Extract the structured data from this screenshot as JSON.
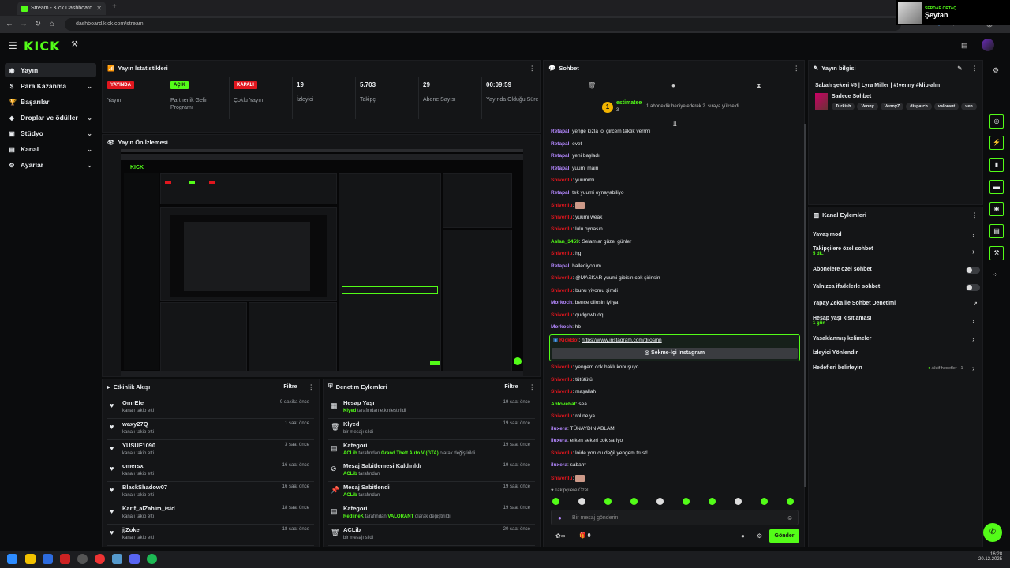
{
  "browser": {
    "tab_title": "Stream - Kick Dashboard",
    "url": "dashboard.kick.com/stream",
    "new_tab": "+"
  },
  "overlay": {
    "name_small": "SERDAR ORTAÇ",
    "name_large": "Şeytan"
  },
  "header": {
    "logo": "KICK"
  },
  "sidebar": {
    "items": [
      {
        "label": "Yayın",
        "icon": "broadcast-icon",
        "chev": ""
      },
      {
        "label": "Para Kazanma",
        "icon": "money-icon",
        "chev": "⌄"
      },
      {
        "label": "Başarılar",
        "icon": "trophy-icon",
        "chev": ""
      },
      {
        "label": "Droplar ve ödüller",
        "icon": "gift-icon",
        "chev": "⌄"
      },
      {
        "label": "Stüdyo",
        "icon": "studio-icon",
        "chev": "⌄"
      },
      {
        "label": "Kanal",
        "icon": "channel-icon",
        "chev": "⌄"
      },
      {
        "label": "Ayarlar",
        "icon": "gear-icon",
        "chev": "⌄"
      }
    ]
  },
  "stats": {
    "title": "Yayın İstatistikleri",
    "items": [
      {
        "value": "YAYINDA",
        "label": "Yayın",
        "kind": "red"
      },
      {
        "value": "AÇIK",
        "label": "Partnerlik Gelir Programı",
        "kind": "green"
      },
      {
        "value": "KAPALI",
        "label": "Çoklu Yayın",
        "kind": "red"
      },
      {
        "value": "19",
        "label": "İzleyici",
        "kind": "num"
      },
      {
        "value": "5.703",
        "label": "Takipçi",
        "kind": "num"
      },
      {
        "value": "29",
        "label": "Abone Sayısı",
        "kind": "num"
      },
      {
        "value": "00:09:59",
        "label": "Yayında Olduğu Süre",
        "kind": "num"
      }
    ]
  },
  "preview": {
    "title": "Yayın Ön İzlemesi"
  },
  "activity": {
    "title": "Etkinlik Akışı",
    "filter": "Filtre",
    "rows": [
      {
        "name": "OmrEfe",
        "sub": "kanalı takip etti",
        "time": "9 dakika önce"
      },
      {
        "name": "waxy27Q",
        "sub": "kanalı takip etti",
        "time": "1 saat önce"
      },
      {
        "name": "YUSUF1090",
        "sub": "kanalı takip etti",
        "time": "3 saat önce"
      },
      {
        "name": "omersx",
        "sub": "kanalı takip etti",
        "time": "16 saat önce"
      },
      {
        "name": "BlackShadow07",
        "sub": "kanalı takip etti",
        "time": "16 saat önce"
      },
      {
        "name": "Karif_alZahim_isid",
        "sub": "kanalı takip etti",
        "time": "18 saat önce"
      },
      {
        "name": "jjZoke",
        "sub": "kanalı takip etti",
        "time": "18 saat önce"
      }
    ]
  },
  "moderation": {
    "title": "Denetim Eylemleri",
    "filter": "Filtre",
    "rows": [
      {
        "name": "Hesap Yaşı",
        "actor": "Klyed",
        "sub": " tarafından etkinleştirildi",
        "extra": "",
        "tail": "",
        "time": "19 saat önce",
        "icon": "calendar-icon"
      },
      {
        "name": "Klyed",
        "actor": "",
        "sub": "bir mesajı sildi",
        "extra": "",
        "tail": "",
        "time": "19 saat önce",
        "icon": "trash-icon"
      },
      {
        "name": "Kategori",
        "actor": "ACLib",
        "sub": " tarafından ",
        "extra": "Grand Theft Auto V (GTA)",
        "tail": " olarak değiştirildi",
        "time": "19 saat önce",
        "icon": "category-icon"
      },
      {
        "name": "Mesaj Sabitlemesi Kaldırıldı",
        "actor": "ACLib",
        "sub": " tarafından",
        "extra": "",
        "tail": "",
        "time": "19 saat önce",
        "icon": "unpin-icon"
      },
      {
        "name": "Mesaj Sabitlendi",
        "actor": "ACLib",
        "sub": " tarafından",
        "extra": "",
        "tail": "",
        "time": "19 saat önce",
        "icon": "pin-icon"
      },
      {
        "name": "Kategori",
        "actor": "RedlineK",
        "sub": " tarafından ",
        "extra": "VALORANT",
        "tail": " olarak değiştirildi",
        "time": "19 saat önce",
        "icon": "category-icon"
      },
      {
        "name": "ACLib",
        "actor": "",
        "sub": "bir mesajı sildi",
        "extra": "",
        "tail": "",
        "time": "20 saat önce",
        "icon": "trash-icon"
      }
    ]
  },
  "chat": {
    "title": "Sohbet",
    "gift_user": "estimatee",
    "gift_count": "3",
    "gift_text": "1 aboneklik hediye ederek 2. sıraya yükseldi",
    "messages": [
      {
        "user": "Retapal",
        "text": "yenge kızla lol gircem taktik verrmi",
        "color": "#b488ff"
      },
      {
        "user": "Retapal",
        "text": "evet",
        "color": "#b488ff"
      },
      {
        "user": "Retapal",
        "text": "yeni başladı",
        "color": "#b488ff"
      },
      {
        "user": "Retapal",
        "text": "yuumi main",
        "color": "#b488ff"
      },
      {
        "user": "Shiverllu",
        "text": "yuumimi",
        "color": "#e0161e"
      },
      {
        "user": "Retapal",
        "text": "tek yuumi oynayabiliyo",
        "color": "#b488ff"
      },
      {
        "user": "Shiverllu",
        "text": "",
        "color": "#e0161e"
      },
      {
        "user": "Shiverllu",
        "text": "yuumi weak",
        "color": "#e0161e"
      },
      {
        "user": "Shiverllu",
        "text": "lulu oynasın",
        "color": "#e0161e"
      },
      {
        "user": "Aslan_3459",
        "text": "Selamlar güzel günler",
        "color": "#53fc18"
      },
      {
        "user": "Shiverllu",
        "text": "hg",
        "color": "#e0161e"
      },
      {
        "user": "Retapal",
        "text": "hallediyorum",
        "color": "#b488ff"
      },
      {
        "user": "Shiverllu",
        "text": "@MASKAR yuumi gibisin cok şirinsin",
        "color": "#e0161e"
      },
      {
        "user": "Shiverllu",
        "text": "bunu yiyomu şimdi",
        "color": "#e0161e"
      },
      {
        "user": "Morkoch",
        "text": "bence dilosin iyi ya",
        "color": "#b488ff"
      },
      {
        "user": "Shiverllu",
        "text": "qudgqwtudq",
        "color": "#e0161e"
      },
      {
        "user": "Morkoch",
        "text": "hb",
        "color": "#b488ff"
      }
    ],
    "bot_user": "KickBot",
    "bot_link": "https://www.instagram.com/dilosinn",
    "bot_button": "Sekme-İçi Instagram",
    "messages2": [
      {
        "user": "Shiverllu",
        "text": "yengem cok haklı konuşuyo",
        "color": "#e0161e"
      },
      {
        "user": "Shiverllu",
        "text": "tütütütü",
        "color": "#e0161e"
      },
      {
        "user": "Shiverllu",
        "text": "maşallah",
        "color": "#e0161e"
      },
      {
        "user": "Antovehat",
        "text": "sea",
        "color": "#53fc18"
      },
      {
        "user": "Shiverllu",
        "text": "rol ne ya",
        "color": "#e0161e"
      },
      {
        "user": "iluxera",
        "text": "TÜNAYDIN ABLAM",
        "color": "#b488ff"
      },
      {
        "user": "iluxera",
        "text": "erken sekeri cok sarlyo",
        "color": "#b488ff"
      },
      {
        "user": "Shiverllu",
        "text": "loide yorucu değil yengem trust!",
        "color": "#e0161e"
      },
      {
        "user": "iluxera",
        "text": "sabah*",
        "color": "#b488ff"
      },
      {
        "user": "Shiverllu",
        "text": "",
        "color": "#e0161e"
      }
    ],
    "followers_only": "Takipçilere Özel",
    "input_placeholder": "Bir mesaj gönderin",
    "count": "0",
    "send": "Gönder"
  },
  "stream_info": {
    "title": "Yayın bilgisi",
    "stream_title": "Sabah şekeri #5 | Lyra Miller | #!venny #klip-alın",
    "category": "Sadece Sohbet",
    "tags": [
      "Turkish",
      "Venny",
      "VennyZ",
      "dispatch",
      "valorant",
      "ven"
    ]
  },
  "channel_actions": {
    "title": "Kanal Eylemleri",
    "items": [
      {
        "label": "Yavaş mod",
        "sub": "",
        "ctl": "chev"
      },
      {
        "label": "Takipçilere özel sohbet",
        "sub": "5 dk.",
        "ctl": "chev"
      },
      {
        "label": "Abonelere özel sohbet",
        "sub": "",
        "ctl": "toggle"
      },
      {
        "label": "Yalnızca ifadelerle sohbet",
        "sub": "",
        "ctl": "toggle"
      },
      {
        "label": "Yapay Zeka ile Sohbet Denetimi",
        "sub": "",
        "ctl": "ext"
      },
      {
        "label": "Hesap yaşı kısıtlaması",
        "sub": "1 gün",
        "ctl": "chev"
      },
      {
        "label": "Yasaklanmış kelimeler",
        "sub": "",
        "ctl": "chev"
      },
      {
        "label": "İzleyici Yönlendir",
        "sub": "",
        "ctl": ""
      },
      {
        "label": "Hedefleri belirleyin",
        "sub": "",
        "ctl": "chev"
      }
    ],
    "goals_status": "Aktif hedefler - 1"
  },
  "taskbar": {
    "time": "16:28",
    "date": "20.12.2025"
  }
}
